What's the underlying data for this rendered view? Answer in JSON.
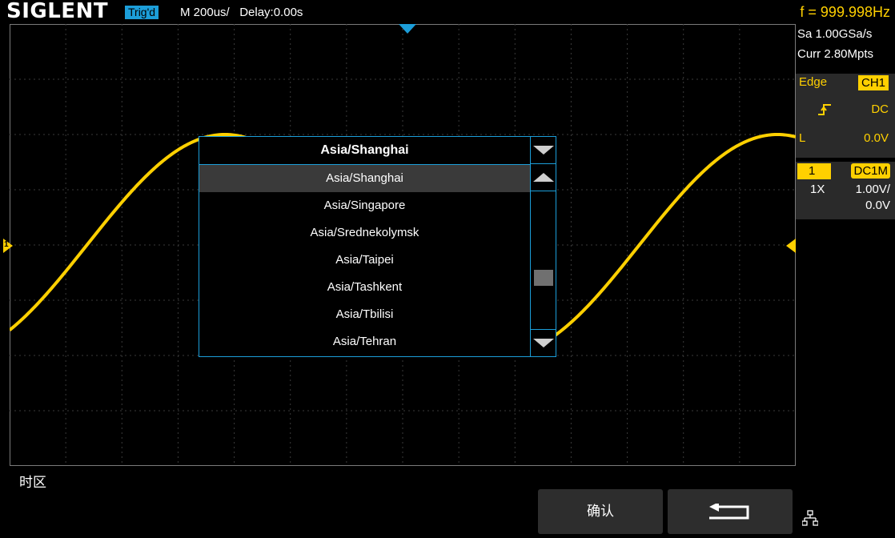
{
  "header": {
    "brand": "SIGLENT",
    "trigger_status": "Trig'd",
    "timebase_delay": "M 200us/   Delay:0.00s",
    "frequency": "f = 999.998Hz"
  },
  "acquisition": {
    "sample_rate": "Sa 1.00GSa/s",
    "memory_depth": "Curr 2.80Mpts"
  },
  "trigger": {
    "type": "Edge",
    "source": "CH1",
    "slope_icon": "rising-edge-icon",
    "coupling": "DC",
    "level_label": "L",
    "level_value": "0.0V"
  },
  "channel1": {
    "number": "1",
    "coupling_impedance": "DC1M",
    "probe": "1X",
    "scale": "1.00V/",
    "offset": "0.0V",
    "color": "#ffd000"
  },
  "ground_marker_label": "1",
  "timezone_dialog": {
    "current_value": "Asia/Shanghai",
    "options": [
      "Asia/Shanghai",
      "Asia/Singapore",
      "Asia/Srednekolymsk",
      "Asia/Taipei",
      "Asia/Tashkent",
      "Asia/Tbilisi",
      "Asia/Tehran"
    ],
    "selected_index": 0
  },
  "menu": {
    "title": "时区",
    "confirm_label": "确认",
    "back_icon": "back-arrow-icon",
    "network_icon": "network-icon"
  },
  "colors": {
    "accent": "#1c9ed9",
    "trace": "#ffd000"
  }
}
